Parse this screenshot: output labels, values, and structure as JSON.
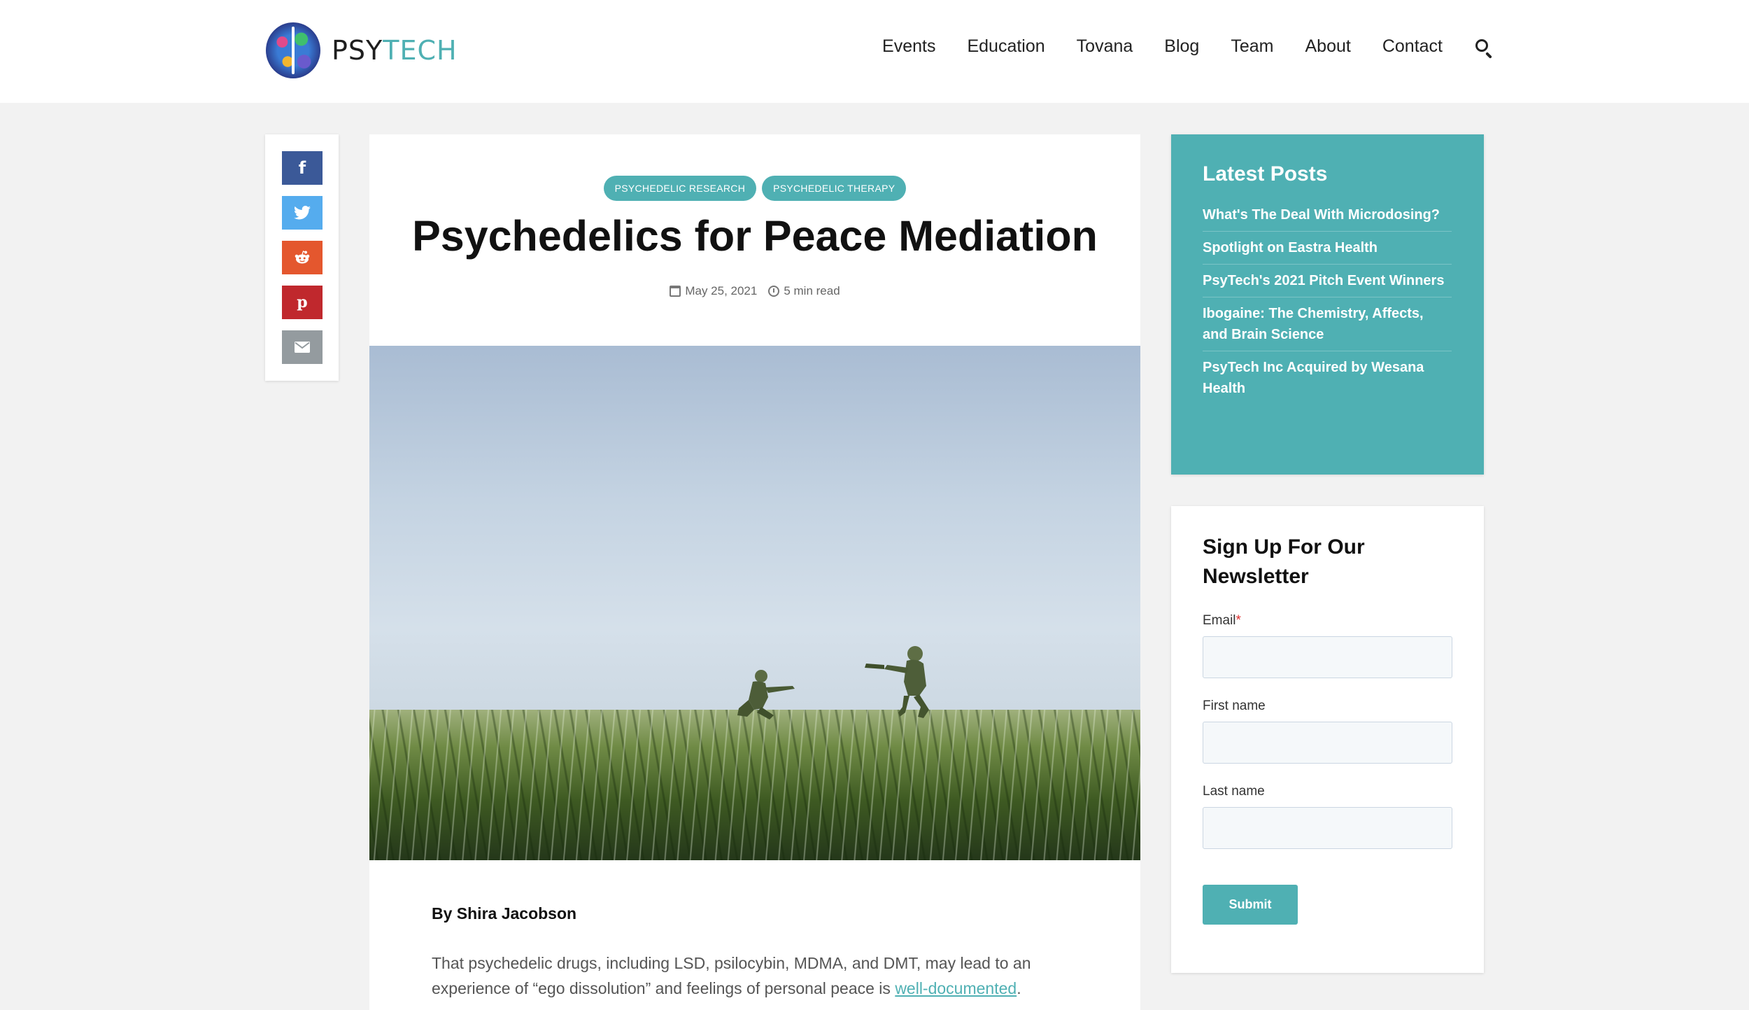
{
  "header": {
    "logo_left": "PSY",
    "logo_right": "TECH",
    "nav": [
      "Events",
      "Education",
      "Tovana",
      "Blog",
      "Team",
      "About",
      "Contact"
    ]
  },
  "share": {
    "facebook": "f",
    "twitter": "twitter-icon",
    "reddit": "reddit-icon",
    "pinterest": "p",
    "email": "email-icon"
  },
  "article": {
    "tags": [
      "PSYCHEDELIC RESEARCH",
      "PSYCHEDELIC THERAPY"
    ],
    "title": "Psychedelics for Peace Mediation",
    "date": "May 25, 2021",
    "read_time": "5 min read",
    "byline": "By Shira Jacobson",
    "body_before_link": "That psychedelic drugs, including LSD, psilocybin, MDMA, and DMT, may lead to an experience of “ego dissolution” and feelings of personal peace is ",
    "body_link": "well-documented",
    "body_after_link": "."
  },
  "latest_posts": {
    "title": "Latest Posts",
    "items": [
      "What's The Deal With Microdosing?",
      "Spotlight on Eastra Health",
      "PsyTech's 2021 Pitch Event Winners",
      "Ibogaine: The Chemistry, Affects, and Brain Science",
      "PsyTech Inc Acquired by Wesana Health"
    ]
  },
  "newsletter": {
    "title": "Sign Up For Our Newsletter",
    "email_label": "Email",
    "required_mark": "*",
    "first_name_label": "First name",
    "last_name_label": "Last name",
    "submit_label": "Submit"
  },
  "colors": {
    "accent": "#4fb0b3",
    "facebook": "#3b5998",
    "twitter": "#55acee",
    "reddit": "#e4572e",
    "pinterest": "#c0282d",
    "email": "#949b9f"
  }
}
